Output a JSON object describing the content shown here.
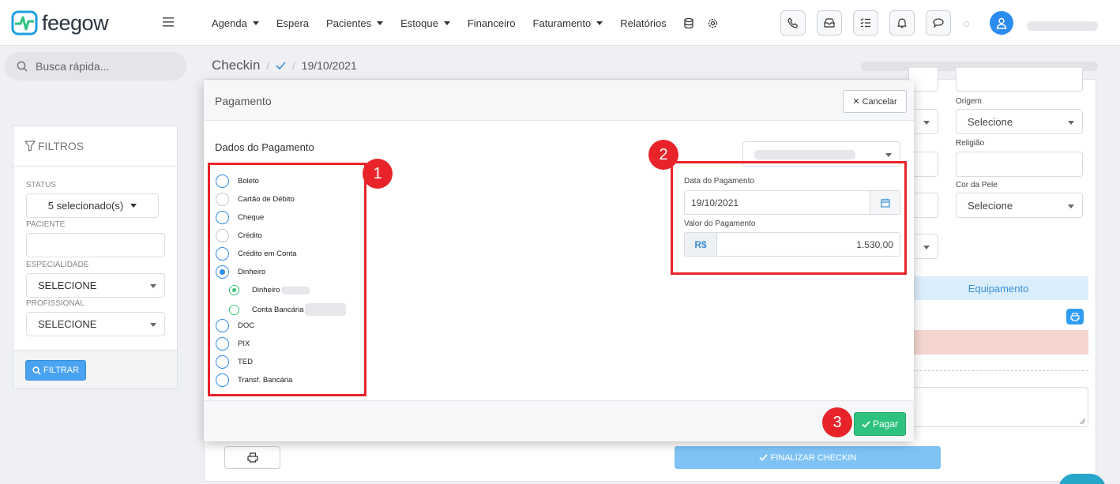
{
  "app": {
    "logo": "feegow"
  },
  "nav": {
    "items": [
      {
        "label": "Agenda",
        "dropdown": true
      },
      {
        "label": "Espera",
        "dropdown": false
      },
      {
        "label": "Pacientes",
        "dropdown": true
      },
      {
        "label": "Estoque",
        "dropdown": true
      },
      {
        "label": "Financeiro",
        "dropdown": false
      },
      {
        "label": "Faturamento",
        "dropdown": true
      },
      {
        "label": "Relatórios",
        "dropdown": false
      }
    ],
    "icons": [
      "database-icon",
      "settings-icon"
    ],
    "tool_buttons": [
      "phone-icon",
      "inbox-icon",
      "checklist-icon",
      "bell-icon",
      "chat-icon"
    ]
  },
  "sidebar": {
    "search_placeholder": "Busca rápida...",
    "filters_title": "FILTROS",
    "status_label": "STATUS",
    "status_value": "5 selecionado(s)",
    "patient_label": "PACIENTE",
    "specialty_label": "ESPECIALIDADE",
    "specialty_value": "SELECIONE",
    "professional_label": "PROFISSIONAL",
    "professional_value": "SELECIONE",
    "filter_button": "FILTRAR"
  },
  "breadcrumb": {
    "title": "Checkin",
    "sep1": "/",
    "sep2": "/",
    "date": "19/10/2021"
  },
  "background_form": {
    "origem_label": "Origem",
    "origem_value": "Selecione",
    "religiao_label": "Religião",
    "cor_label": "Cor da Pele",
    "cor_value": "Selecione",
    "equipamento": "Equipamento",
    "finalizar": "FINALIZAR CHECKIN"
  },
  "modal": {
    "title": "Pagamento",
    "cancel": "Cancelar",
    "section": "Dados do Pagamento",
    "payment_methods": [
      {
        "label": "Boleto",
        "state": "empty"
      },
      {
        "label": "Cartão de Débito",
        "state": "disabled"
      },
      {
        "label": "Cheque",
        "state": "empty"
      },
      {
        "label": "Crédito",
        "state": "disabled"
      },
      {
        "label": "Crédito em Conta",
        "state": "empty"
      },
      {
        "label": "Dinheiro",
        "state": "selected"
      }
    ],
    "sub_methods": [
      {
        "label": "Dinheiro",
        "selected": true
      },
      {
        "label": "Conta Bancária",
        "selected": false
      }
    ],
    "payment_methods_2": [
      {
        "label": "DOC"
      },
      {
        "label": "PIX"
      },
      {
        "label": "TED"
      },
      {
        "label": "Transf. Bancária"
      }
    ],
    "date_label": "Data do Pagamento",
    "date_value": "19/10/2021",
    "amount_label": "Valor do Pagamento",
    "currency": "R$",
    "amount_value": "1.530,00",
    "pay_button": "Pagar"
  },
  "annotations": {
    "badge1": "1",
    "badge2": "2",
    "badge3": "3",
    "highlight_color": "#e8242a"
  }
}
